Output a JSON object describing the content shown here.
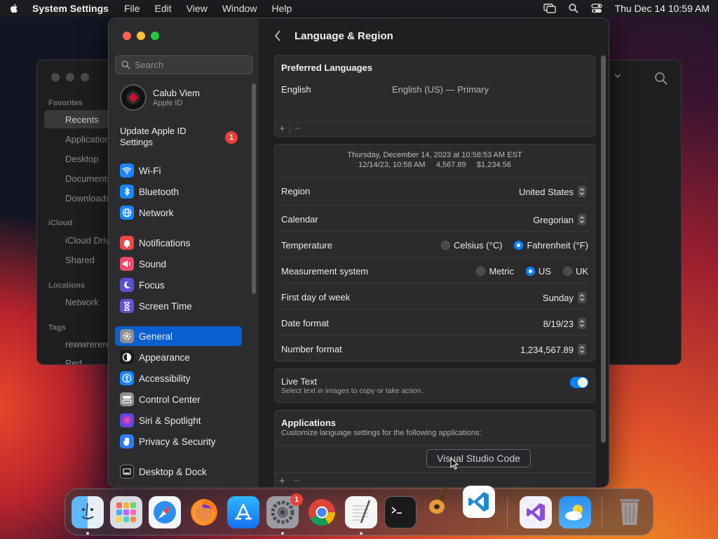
{
  "menubar": {
    "app_name": "System Settings",
    "menus": [
      "File",
      "Edit",
      "View",
      "Window",
      "Help"
    ],
    "clock": "Thu Dec 14  10:59 AM"
  },
  "finder": {
    "sections": [
      {
        "title": "Favorites",
        "items": [
          "Recents",
          "Applications",
          "Desktop",
          "Documents",
          "Downloads"
        ]
      },
      {
        "title": "iCloud",
        "items": [
          "iCloud Drive",
          "Shared"
        ]
      },
      {
        "title": "Locations",
        "items": [
          "Network"
        ]
      },
      {
        "title": "Tags",
        "items": [
          "rewwrerere",
          "Red"
        ]
      }
    ]
  },
  "sidebar": {
    "search_placeholder": "Search",
    "profile_name": "Calub Viem",
    "profile_sub": "Apple ID",
    "update_label": "Update Apple ID Settings",
    "update_badge": "1",
    "items": [
      {
        "label": "Wi-Fi",
        "icon": "wifi-icon",
        "color": "#1a84ff"
      },
      {
        "label": "Bluetooth",
        "icon": "bluetooth-icon",
        "color": "#1a84ff"
      },
      {
        "label": "Network",
        "icon": "globe-icon",
        "color": "#1a84ff"
      },
      {
        "label": "Notifications",
        "icon": "bell-icon",
        "color": "#ec4545"
      },
      {
        "label": "Sound",
        "icon": "speaker-icon",
        "color": "#ec4a6a"
      },
      {
        "label": "Focus",
        "icon": "moon-icon",
        "color": "#5a4fd6"
      },
      {
        "label": "Screen Time",
        "icon": "hourglass-icon",
        "color": "#6a4fd6"
      },
      {
        "label": "General",
        "icon": "gear-icon",
        "color": "#8e8e93"
      },
      {
        "label": "Appearance",
        "icon": "appearance-icon",
        "color": "#1c1c1e"
      },
      {
        "label": "Accessibility",
        "icon": "accessibility-icon",
        "color": "#1a84ff"
      },
      {
        "label": "Control Center",
        "icon": "toggles-icon",
        "color": "#8e8e93"
      },
      {
        "label": "Siri & Spotlight",
        "icon": "siri-icon",
        "color": "#b23ad1"
      },
      {
        "label": "Privacy & Security",
        "icon": "hand-icon",
        "color": "#2f7cf6"
      },
      {
        "label": "Desktop & Dock",
        "icon": "dock-icon",
        "color": "#1c1c1e"
      }
    ]
  },
  "content": {
    "title": "Language & Region",
    "preferred_header": "Preferred Languages",
    "language_name": "English",
    "language_value": "English (US) — Primary",
    "add_symbol": "+",
    "remove_symbol": "−",
    "preview_line1": "Thursday, December 14, 2023 at 10:58:53 AM EST",
    "preview_line2": "12/14/23, 10:58 AM     4,567.89     $1,234.56",
    "region_label": "Region",
    "region_value": "United States",
    "calendar_label": "Calendar",
    "calendar_value": "Gregorian",
    "temperature_label": "Temperature",
    "temp_options": [
      "Celsius (°C)",
      "Fahrenheit (°F)"
    ],
    "temp_selected": "Fahrenheit (°F)",
    "measurement_label": "Measurement system",
    "measure_options": [
      "Metric",
      "US",
      "UK"
    ],
    "measure_selected": "US",
    "first_day_label": "First day of week",
    "first_day_value": "Sunday",
    "date_format_label": "Date format",
    "date_format_value": "8/19/23",
    "number_format_label": "Number format",
    "number_format_value": "1,234,567.89",
    "live_text_title": "Live Text",
    "live_text_sub": "Select text in images to copy or take action.",
    "apps_title": "Applications",
    "apps_sub": "Customize language settings for the following applications:"
  },
  "tooltip": "Visual Studio Code",
  "dock": {
    "apps": [
      "Finder",
      "Launchpad",
      "Safari",
      "Firefox",
      "App Store",
      "System Settings",
      "Chrome",
      "TextEdit",
      "Terminal",
      "GarageBand",
      "Visual Studio Code",
      "Visual Studio",
      "Weather",
      "Trash"
    ],
    "settings_badge": "1"
  },
  "colors": {
    "accent": "#0a84ff",
    "selection": "#0a5fd1",
    "badge": "#e8403a"
  }
}
